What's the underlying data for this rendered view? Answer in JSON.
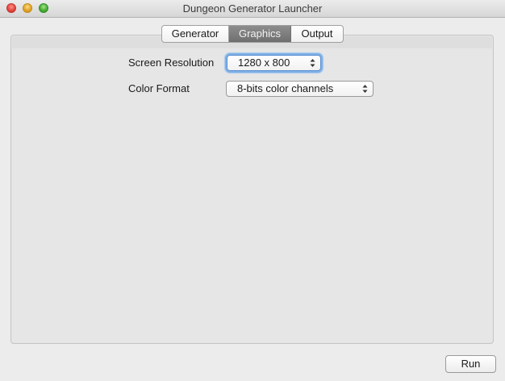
{
  "window": {
    "title": "Dungeon Generator Launcher"
  },
  "tabs": [
    {
      "label": "Generator",
      "selected": false
    },
    {
      "label": "Graphics",
      "selected": true
    },
    {
      "label": "Output",
      "selected": false
    }
  ],
  "graphics": {
    "screen_resolution": {
      "label": "Screen Resolution",
      "value": "1280 x 800"
    },
    "color_format": {
      "label": "Color Format",
      "value": "8-bits color channels"
    }
  },
  "footer": {
    "run_label": "Run"
  },
  "colors": {
    "selected_tab": "#7e7e7e",
    "focus_ring": "#7fb1e8",
    "window_bg": "#ececec"
  },
  "icons": [
    "close-window-icon",
    "minimize-window-icon",
    "zoom-window-icon",
    "popup-arrows-icon"
  ]
}
